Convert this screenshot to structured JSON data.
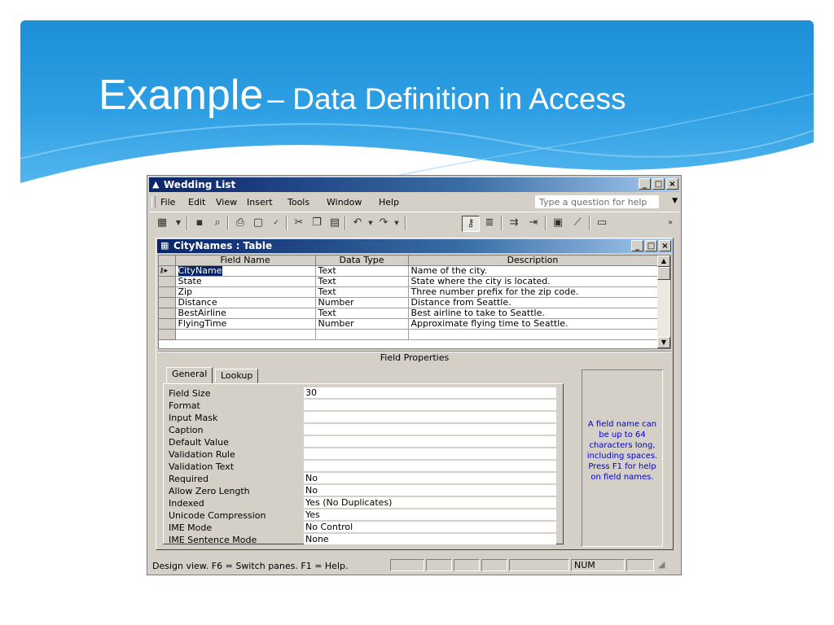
{
  "slide": {
    "title_main": "Example",
    "title_rest": "– Data Definition in Access"
  },
  "colors": {
    "header_blue": "#1d8fd8",
    "titlebar_active": "#0a246a",
    "help_text": "#0000cc"
  },
  "window": {
    "title": "Wedding List",
    "menu": [
      "File",
      "Edit",
      "View",
      "Insert",
      "Tools",
      "Window",
      "Help"
    ],
    "help_placeholder": "Type a question for help",
    "toolbar_icons": [
      "view-icon",
      "save-icon",
      "search-icon",
      "print-icon",
      "print-preview-icon",
      "spelling-icon",
      "cut-icon",
      "copy-icon",
      "paste-icon",
      "undo-icon",
      "redo-icon",
      "primary-key-icon",
      "indexes-icon",
      "insert-rows-icon",
      "delete-rows-icon",
      "properties-icon",
      "build-icon",
      "database-window-icon"
    ]
  },
  "table_window": {
    "title": "CityNames : Table",
    "columns": [
      "Field Name",
      "Data Type",
      "Description"
    ],
    "rows": [
      {
        "field": "CityName",
        "type": "Text",
        "description": "Name of the city."
      },
      {
        "field": "State",
        "type": "Text",
        "description": "State where the city is located."
      },
      {
        "field": "Zip",
        "type": "Text",
        "description": "Three number prefix for the zip code."
      },
      {
        "field": "Distance",
        "type": "Number",
        "description": "Distance from Seattle."
      },
      {
        "field": "BestAirline",
        "type": "Text",
        "description": "Best airline to take to Seattle."
      },
      {
        "field": "FlyingTime",
        "type": "Number",
        "description": "Approximate flying time to Seattle."
      }
    ],
    "field_properties_label": "Field Properties",
    "tabs": [
      "General",
      "Lookup"
    ],
    "properties": [
      {
        "label": "Field Size",
        "value": "30"
      },
      {
        "label": "Format",
        "value": ""
      },
      {
        "label": "Input Mask",
        "value": ""
      },
      {
        "label": "Caption",
        "value": ""
      },
      {
        "label": "Default Value",
        "value": ""
      },
      {
        "label": "Validation Rule",
        "value": ""
      },
      {
        "label": "Validation Text",
        "value": ""
      },
      {
        "label": "Required",
        "value": "No"
      },
      {
        "label": "Allow Zero Length",
        "value": "No"
      },
      {
        "label": "Indexed",
        "value": "Yes (No Duplicates)"
      },
      {
        "label": "Unicode Compression",
        "value": "Yes"
      },
      {
        "label": "IME Mode",
        "value": "No Control"
      },
      {
        "label": "IME Sentence Mode",
        "value": "None"
      }
    ],
    "help_text": "A field name can be up to 64 characters long, including spaces.  Press F1 for help on field names."
  },
  "status": {
    "text": "Design view.  F6 = Switch panes.  F1 = Help.",
    "num": "NUM"
  }
}
